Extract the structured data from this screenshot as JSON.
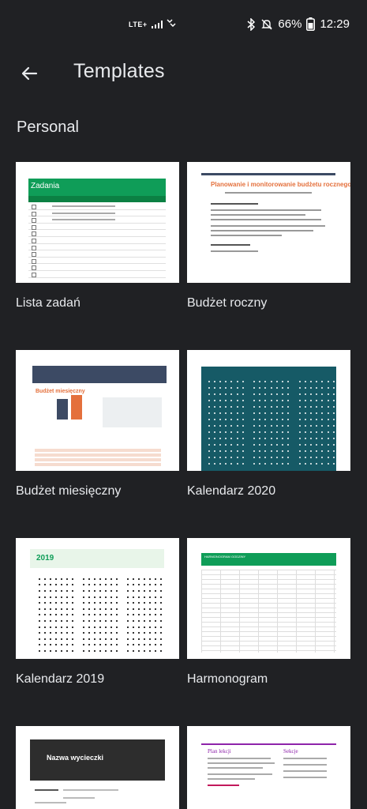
{
  "status_bar": {
    "network": "LTE+",
    "battery": "66%",
    "time": "12:29"
  },
  "app_bar": {
    "title": "Templates"
  },
  "section": {
    "title": "Personal"
  },
  "templates": [
    {
      "label": "Lista zadań",
      "thumb_title": "Zadania"
    },
    {
      "label": "Budżet roczny",
      "thumb_title": "Planowanie i monitorowanie budżetu rocznego"
    },
    {
      "label": "Budżet miesięczny",
      "thumb_title": "Budżet miesięczny"
    },
    {
      "label": "Kalendarz 2020"
    },
    {
      "label": "Kalendarz 2019",
      "thumb_title": "2019"
    },
    {
      "label": "Harmonogram",
      "thumb_title": "HARMONOGRAM GODZINY"
    },
    {
      "label": "",
      "thumb_title": "Nazwa wycieczki"
    },
    {
      "label": "",
      "thumb_title": "Plan lekcji",
      "thumb_subtitle": "Sekcje"
    }
  ]
}
